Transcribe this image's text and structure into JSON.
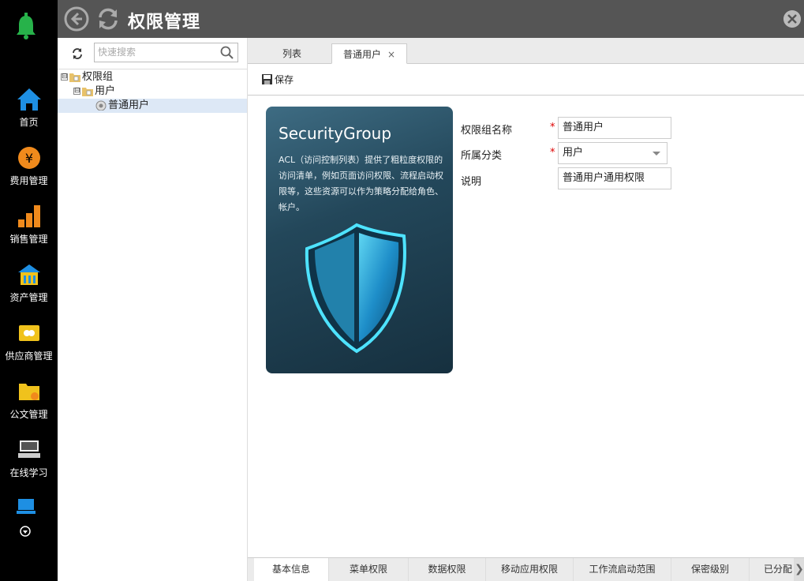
{
  "header": {
    "title": "权限管理"
  },
  "nav": {
    "items": [
      {
        "label": "首页",
        "icon": "home-icon"
      },
      {
        "label": "费用管理",
        "icon": "yen-coin-icon"
      },
      {
        "label": "销售管理",
        "icon": "bar-chart-icon"
      },
      {
        "label": "资产管理",
        "icon": "building-icon"
      },
      {
        "label": "供应商管理",
        "icon": "handshake-folder-icon"
      },
      {
        "label": "公文管理",
        "icon": "document-folder-icon"
      },
      {
        "label": "在线学习",
        "icon": "keyboard-icon"
      }
    ]
  },
  "tree": {
    "search_placeholder": "快速搜索",
    "nodes": [
      {
        "label": "权限组",
        "toggle": "⊟"
      },
      {
        "label": "用户",
        "toggle": "⊟"
      },
      {
        "label": "普通用户"
      }
    ]
  },
  "tabs": {
    "list_label": "列表",
    "active_label": "普通用户",
    "close": "×"
  },
  "toolbar": {
    "save_label": "保存"
  },
  "card": {
    "title": "SecurityGroup",
    "description": "ACL（访问控制列表）提供了粗粒度权限的访问清单，例如页面访问权限、流程启动权限等，这些资源可以作为策略分配给角色、帐户。"
  },
  "form": {
    "name_label": "权限组名称",
    "name_value": "普通用户",
    "category_label": "所属分类",
    "category_value": "用户",
    "desc_label": "说明",
    "desc_value": "普通用户通用权限",
    "required_mark": "*"
  },
  "bottom_tabs": [
    "基本信息",
    "菜单权限",
    "数据权限",
    "移动应用权限",
    "工作流启动范围",
    "保密级别",
    "已分配"
  ],
  "colors": {
    "nav_bg": "#000000",
    "header_bg": "#555555",
    "required": "#dd0000",
    "selected_row": "#dde8f6"
  }
}
